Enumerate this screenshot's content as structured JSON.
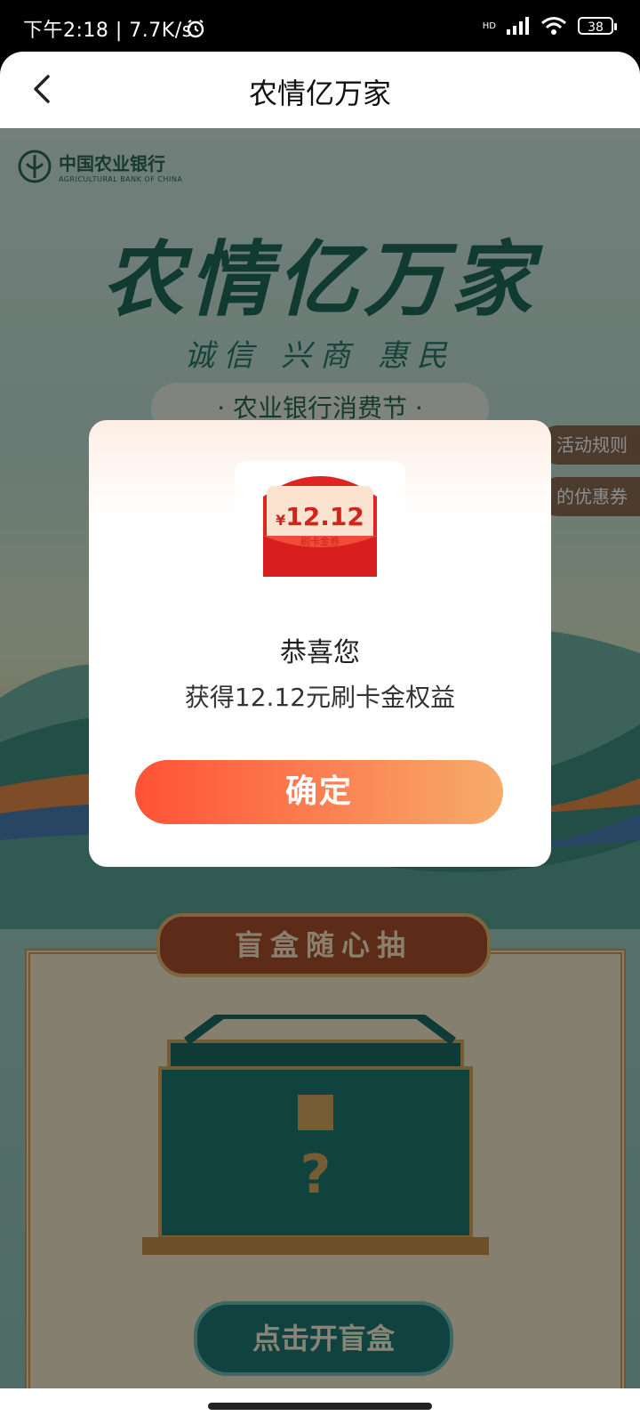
{
  "status_bar": {
    "time_speed": "下午2:18 | 7.7K/s",
    "network": "HD",
    "battery": "38"
  },
  "header": {
    "title": "农情亿万家"
  },
  "page": {
    "bank_name_cn": "中国农业银行",
    "bank_name_en": "AGRICULTURAL BANK OF CHINA",
    "hero_title": "农情亿万家",
    "hero_subtitle": "诚信 兴商 惠民",
    "festival_label": "· 农业银行消费节 ·",
    "rules_tab": "活动规则",
    "coupons_tab": "的优惠券",
    "blindbox_title": "盲盒随心抽",
    "open_button": "点击开盲盒"
  },
  "dialog": {
    "voucher_amount": "12.12",
    "voucher_currency": "¥",
    "voucher_label": "刷卡金券",
    "congrats": "恭喜您",
    "reward_text": "获得12.12元刷卡金权益",
    "confirm_button": "确定"
  },
  "colors": {
    "confirm_start": "#ff5236",
    "confirm_end": "#f7ac6b",
    "theme_green": "#1f6a58",
    "voucher_red": "#e02424"
  }
}
